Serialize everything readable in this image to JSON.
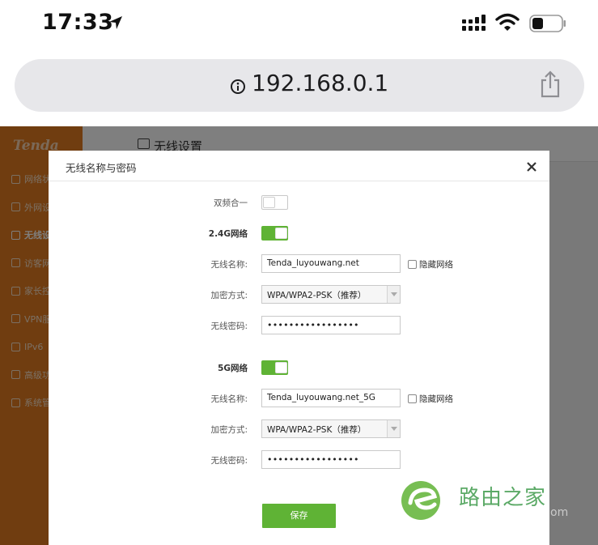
{
  "status_bar": {
    "time": "17:33",
    "icons": [
      "location-arrow-icon",
      "cellular-signal-icon",
      "wifi-icon",
      "battery-icon"
    ]
  },
  "browser": {
    "url": "192.168.0.1",
    "info_icon": "info-icon",
    "share_icon": "share-icon"
  },
  "router_page": {
    "brand": "Tenda",
    "nav_items": [
      {
        "label": "网络状态",
        "icon": "globe-icon"
      },
      {
        "label": "外网设置",
        "icon": "globe-icon"
      },
      {
        "label": "无线设置",
        "icon": "monitor-icon",
        "active": true
      },
      {
        "label": "访客网络",
        "icon": "user-icon"
      },
      {
        "label": "家长控制",
        "icon": "family-icon"
      },
      {
        "label": "VPN服务",
        "icon": "vpn-icon"
      },
      {
        "label": "IPv6",
        "icon": "ipv6-icon"
      },
      {
        "label": "高级功能",
        "icon": "grid-icon"
      },
      {
        "label": "系统管理",
        "icon": "settings-icon"
      }
    ],
    "content_title": "无线设置"
  },
  "modal": {
    "title": "无线名称与密码",
    "close_icon": "close-icon",
    "dual_band": {
      "label": "双频合一",
      "on": false
    },
    "band_24": {
      "label": "2.4G网络",
      "on": true,
      "ssid_label": "无线名称:",
      "ssid": "Tenda_luyouwang.net",
      "hide_label": "隐藏网络",
      "hide_checked": false,
      "security_label": "加密方式:",
      "security": "WPA/WPA2-PSK（推荐）",
      "password_label": "无线密码:",
      "password": "•••••••••••••••••"
    },
    "band_5": {
      "label": "5G网络",
      "on": true,
      "ssid_label": "无线名称:",
      "ssid": "Tenda_luyouwang.net_5G",
      "hide_label": "隐藏网络",
      "hide_checked": false,
      "security_label": "加密方式:",
      "security": "WPA/WPA2-PSK（推荐）",
      "password_label": "无线密码:",
      "password": "•••••••••••••••••"
    },
    "save_label": "保存"
  },
  "watermark": {
    "text": "路由之家",
    "suffix": "om"
  },
  "colors": {
    "sidebar": "#e07b20",
    "accent_green": "#5fb335",
    "overlay": "rgba(0,0,0,0.5)"
  }
}
